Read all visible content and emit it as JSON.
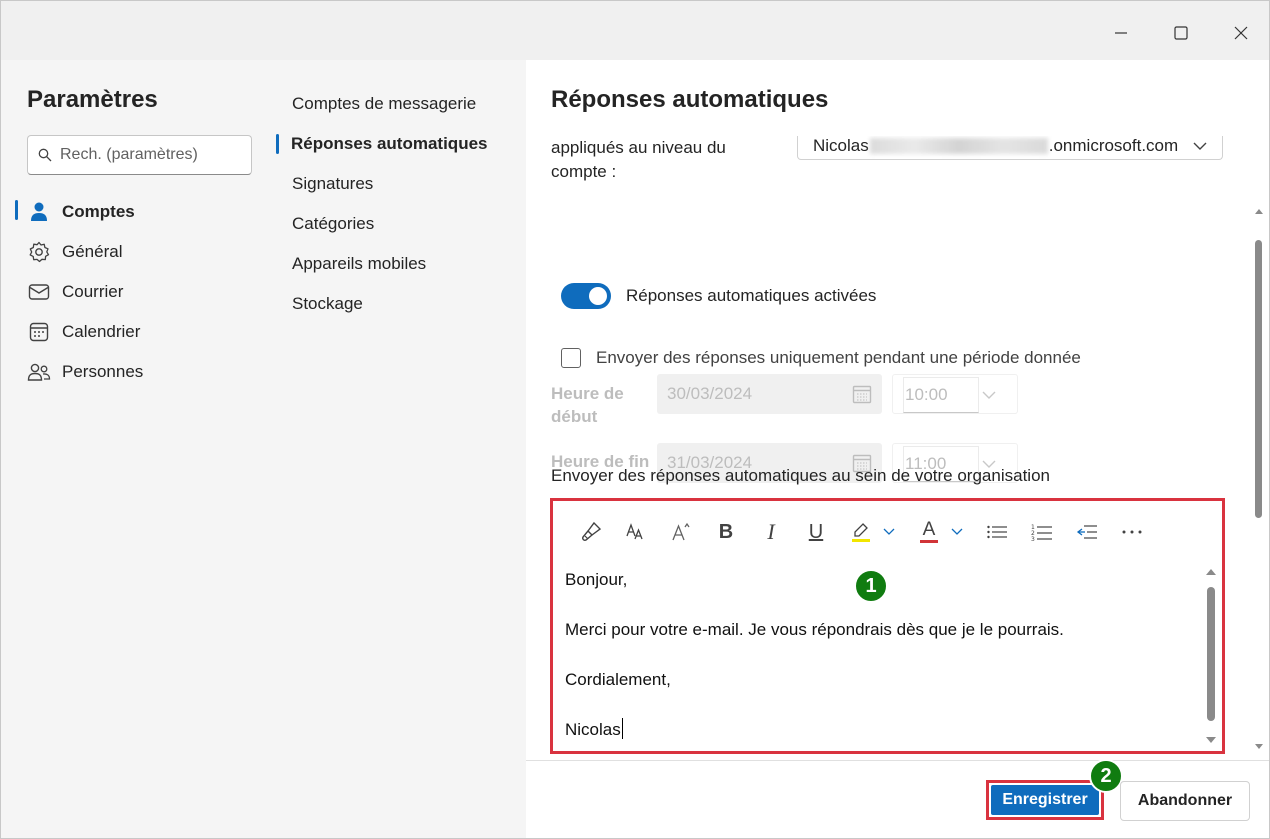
{
  "window": {
    "minimize_icon": "minimize-icon",
    "maximize_icon": "maximize-icon",
    "close_icon": "close-icon"
  },
  "sidebar": {
    "title": "Paramètres",
    "search_placeholder": "Rech. (paramètres)",
    "items": [
      {
        "label": "Comptes",
        "icon": "person-icon",
        "active": true
      },
      {
        "label": "Général",
        "icon": "gear-icon"
      },
      {
        "label": "Courrier",
        "icon": "mail-icon"
      },
      {
        "label": "Calendrier",
        "icon": "calendar-icon"
      },
      {
        "label": "Personnes",
        "icon": "people-icon"
      }
    ]
  },
  "subnav": {
    "items": [
      {
        "label": "Comptes de messagerie"
      },
      {
        "label": "Réponses automatiques",
        "active": true
      },
      {
        "label": "Signatures"
      },
      {
        "label": "Catégories"
      },
      {
        "label": "Appareils mobiles"
      },
      {
        "label": "Stockage"
      }
    ]
  },
  "main": {
    "title": "Réponses automatiques",
    "account_label": "appliqués au niveau du compte :",
    "account_prefix": "Nicolas",
    "account_suffix": ".onmicrosoft.com",
    "toggle_label": "Réponses automatiques activées",
    "toggle_on": true,
    "period_checkbox_label": "Envoyer des réponses uniquement pendant une période donnée",
    "period_checked": false,
    "start_label": "Heure de début",
    "start_date": "30/03/2024",
    "start_time": "10:00",
    "end_label": "Heure de fin",
    "end_date": "31/03/2024",
    "end_time": "11:00",
    "internal_section_label": "Envoyer des réponses automatiques au sein de votre organisation",
    "editor": {
      "toolbar": [
        "format-painter-icon",
        "font-size-icon",
        "grow-font-icon",
        "bold-icon",
        "italic-icon",
        "underline-icon",
        "highlight-icon",
        "font-color-icon",
        "bullets-icon",
        "numbering-icon",
        "decrease-indent-icon",
        "more-icon"
      ],
      "bold_glyph": "B",
      "italic_glyph": "I",
      "underline_glyph": "U",
      "font_color_glyph": "A",
      "lines": [
        "Bonjour,",
        "Merci pour votre e-mail. Je vous répondrais dès que je le pourrais.",
        "Cordialement,",
        "Nicolas"
      ]
    },
    "callout_1": "1",
    "callout_2": "2",
    "save_label": "Enregistrer",
    "cancel_label": "Abandonner"
  },
  "colors": {
    "accent": "#0f6cbd",
    "highlight_border": "#d9333f",
    "callout_green": "#107c10"
  }
}
